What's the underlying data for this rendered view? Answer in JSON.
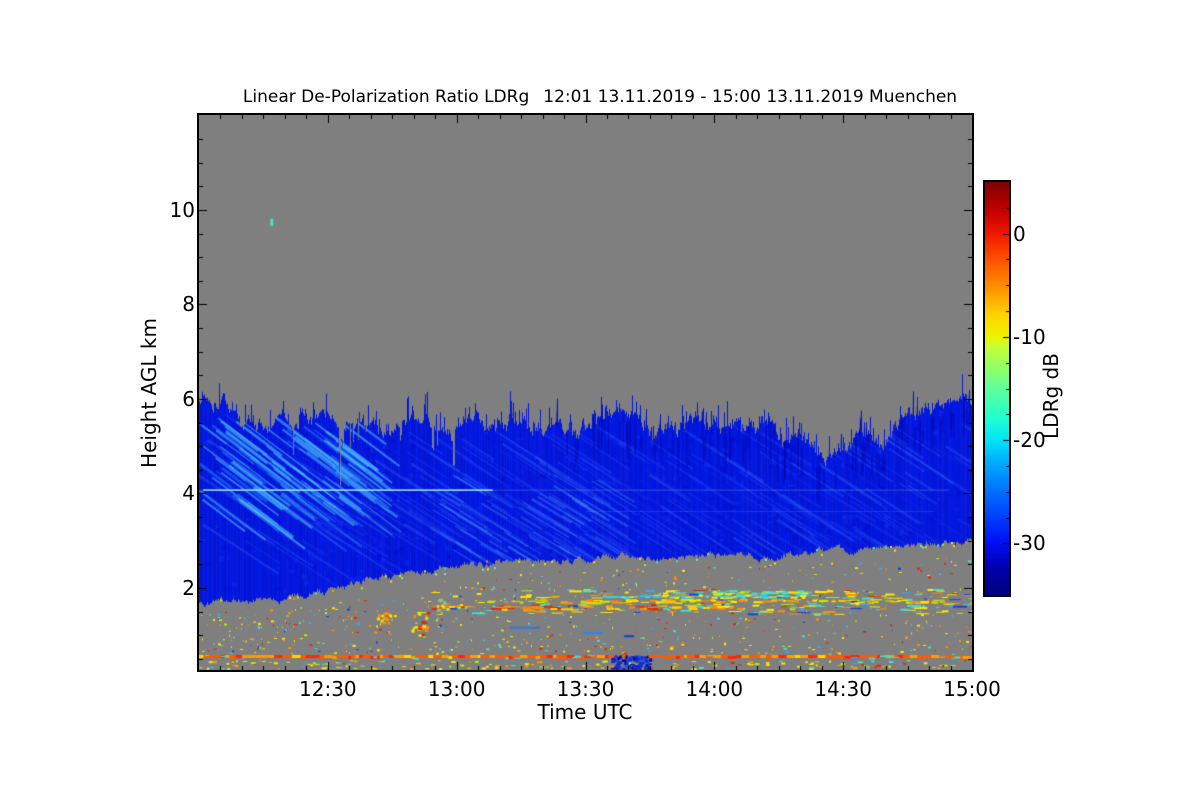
{
  "title": {
    "main": "Linear De-Polarization Ratio LDRg",
    "range": "12:01 13.11.2019 - 15:00 13.11.2019 Muenchen"
  },
  "axes": {
    "x_label": "Time UTC",
    "y_label": "Height AGL km"
  },
  "colorbar": {
    "label": "LDRg dB"
  },
  "chart_data": {
    "type": "heatmap",
    "title": "Linear De-Polarization Ratio LDRg  12:01 13.11.2019 - 15:00 13.11.2019 Muenchen",
    "xlabel": "Time UTC",
    "ylabel": "Height AGL km",
    "x_range_utc": [
      "12:00",
      "15:00"
    ],
    "data_start_utc": "12:01",
    "y_range_km": [
      0.26,
      12.0
    ],
    "x_ticks": [
      {
        "label": "12:30",
        "minutes": 30
      },
      {
        "label": "13:00",
        "minutes": 60
      },
      {
        "label": "13:30",
        "minutes": 90
      },
      {
        "label": "14:00",
        "minutes": 120
      },
      {
        "label": "14:30",
        "minutes": 150
      },
      {
        "label": "15:00",
        "minutes": 180
      }
    ],
    "x_minor_step_min": 5,
    "y_ticks": [
      {
        "label": "2",
        "km": 2
      },
      {
        "label": "4",
        "km": 4
      },
      {
        "label": "6",
        "km": 6
      },
      {
        "label": "8",
        "km": 8
      },
      {
        "label": "10",
        "km": 10
      }
    ],
    "y_minor_step_km": 0.5,
    "cbar": {
      "label": "LDRg dB",
      "range_db": [
        -35,
        5
      ],
      "ticks": [
        {
          "label": "0",
          "db": 0
        },
        {
          "label": "-10",
          "db": -10
        },
        {
          "label": "-20",
          "db": -20
        },
        {
          "label": "-30",
          "db": -30
        }
      ],
      "minor_step_db": 2.5,
      "jet_stops": [
        [
          0.0,
          "#00007F"
        ],
        [
          0.06,
          "#0000A8"
        ],
        [
          0.125,
          "#000DF4"
        ],
        [
          0.19,
          "#0040FF"
        ],
        [
          0.26,
          "#0078FF"
        ],
        [
          0.33,
          "#00B4FF"
        ],
        [
          0.375,
          "#00E4F8"
        ],
        [
          0.43,
          "#22FFD0"
        ],
        [
          0.5,
          "#60FF9A"
        ],
        [
          0.56,
          "#9CFF5C"
        ],
        [
          0.6,
          "#C4FF36"
        ],
        [
          0.625,
          "#EEF400"
        ],
        [
          0.68,
          "#FFD200"
        ],
        [
          0.75,
          "#FF8C00"
        ],
        [
          0.82,
          "#FF4A00"
        ],
        [
          0.875,
          "#F01800"
        ],
        [
          0.93,
          "#C40000"
        ],
        [
          1.0,
          "#7F0000"
        ]
      ]
    },
    "no_signal_color": "#7F7F7F",
    "seed": 20191113,
    "description": "Depolarization lidar time-height plot: ice/mixed cloud of low LDR (~-32 dB, dark blue with lighter fall streaks) between ~1.7-3 km base and ~5-6 km spiky top; gray = no signal; noisy speckle band (yellow/orange/cyan, LDR -5..-15 dB) at 1.4-2.0 km; continuous orange-red aerosol line at ~0.55 km; lone turquoise echo at 9.75 km 12:17.",
    "layers": {
      "cloud": {
        "body_colors": [
          "#0A1BE0",
          "#0215D5",
          "#0018E2"
        ],
        "top_km": {
          "t": [
            0,
            0.03,
            0.06,
            0.1,
            0.14,
            0.18,
            0.22,
            0.26,
            0.3,
            0.35,
            0.4,
            0.45,
            0.5,
            0.55,
            0.6,
            0.65,
            0.7,
            0.74,
            0.78,
            0.81,
            0.84,
            0.87,
            0.9,
            0.94,
            1.0
          ],
          "v": [
            5.85,
            5.8,
            5.6,
            5.5,
            5.45,
            5.5,
            5.55,
            5.5,
            5.45,
            5.5,
            5.45,
            5.5,
            5.45,
            5.4,
            5.4,
            5.35,
            5.3,
            5.25,
            5.1,
            4.95,
            4.85,
            5.2,
            5.5,
            5.8,
            5.95
          ]
        },
        "base_km": {
          "t": [
            0,
            0.06,
            0.12,
            0.17,
            0.22,
            0.28,
            0.34,
            0.4,
            0.5,
            0.6,
            0.7,
            0.8,
            0.9,
            1.0
          ],
          "v": [
            1.7,
            1.75,
            1.82,
            1.95,
            2.15,
            2.35,
            2.45,
            2.52,
            2.6,
            2.66,
            2.7,
            2.78,
            2.85,
            2.95
          ]
        },
        "mottle": {
          "n": 520,
          "colors": [
            "rgba(8,25,225,0.45)",
            "rgba(0,5,185,0.30)",
            "rgba(25,60,245,0.28)"
          ]
        },
        "streak_sets": [
          {
            "n": 220,
            "t": [
              0,
              1
            ],
            "h": [
              3.0,
              5.7
            ],
            "colors": [
              "rgba(35,70,245,0.35)",
              "rgba(20,40,230,0.30)",
              "rgba(60,110,255,0.30)"
            ],
            "w": [
              1,
              3
            ],
            "len": [
              25,
              85
            ],
            "slope": 0.65
          },
          {
            "n": 110,
            "t": [
              0,
              0.2
            ],
            "h": [
              3.8,
              5.65
            ],
            "colors": [
              "rgba(70,190,255,0.55)",
              "rgba(90,215,255,0.50)",
              "rgba(45,140,255,0.45)"
            ],
            "w": [
              1,
              3
            ],
            "len": [
              25,
              70
            ],
            "slope": 0.75
          },
          {
            "n": 60,
            "t": [
              0.3,
              0.52
            ],
            "h": [
              2.8,
              4.4
            ],
            "colors": [
              "rgba(60,130,255,0.40)",
              "rgba(80,160,255,0.35)"
            ],
            "w": [
              1,
              2.5
            ],
            "len": [
              18,
              55
            ],
            "slope": 0.6
          },
          {
            "n": 120,
            "t": [
              0.12,
              1
            ],
            "h": [
              2.6,
              4.1
            ],
            "colors": [
              "rgba(10,25,215,0.35)",
              "rgba(35,70,240,0.30)"
            ],
            "w": [
              1,
              3
            ],
            "len": [
              20,
              70
            ],
            "slope": 0.6
          }
        ],
        "vertical_dark": {
          "n": 140,
          "t": [
            0.45,
            1.0
          ],
          "color": "rgba(0,6,175,0.45)"
        },
        "bright_line": {
          "h": 4.07,
          "strong_t": [
            0.005,
            0.38
          ],
          "faint_t": [
            0.38,
            0.97
          ],
          "strong_color": "rgba(150,225,255,0.9)",
          "faint_color": "rgba(90,150,255,0.45)"
        },
        "faint_line": {
          "h": 3.62,
          "t": [
            0.5,
            0.95
          ],
          "color": "rgba(80,130,255,0.30)"
        },
        "base_speckles": {
          "n": 48,
          "colors": [
            "#FFE000",
            "#70E8C0",
            "#B8F000",
            "#FF9000",
            "#40E0D0"
          ]
        }
      },
      "sparse_speckles": {
        "n": 640,
        "h_min": 0.62,
        "palette": [
          [
            "#FFE000",
            0.3
          ],
          [
            "#FF9000",
            0.18
          ],
          [
            "#E02800",
            0.13
          ],
          [
            "#40E0D0",
            0.13
          ],
          [
            "#35A8FF",
            0.08
          ],
          [
            "#B8F000",
            0.1
          ],
          [
            "#1040E0",
            0.04
          ],
          [
            "#FF5A00",
            0.04
          ]
        ]
      },
      "band": {
        "n": 240,
        "t": [
          0.27,
          1.0
        ],
        "h": [
          1.45,
          1.98
        ],
        "palette": [
          [
            "#FFE800",
            0.3
          ],
          [
            "#FF9000",
            0.17
          ],
          [
            "#40E0D0",
            0.2
          ],
          [
            "#E02800",
            0.1
          ],
          [
            "#B8F000",
            0.13
          ],
          [
            "#1040E0",
            0.05
          ],
          [
            "#35A8FF",
            0.05
          ]
        ],
        "rows": [
          {
            "n": 60,
            "t": [
              0.52,
              0.78
            ],
            "h": 1.83,
            "colors": [
              "#40E0D0",
              "#30C8E8",
              "#FFE800"
            ]
          },
          {
            "n": 80,
            "t": [
              0.4,
              0.97
            ],
            "h": 1.73,
            "colors": [
              "#FFE800",
              "#FFC800",
              "#FF9000",
              "#B8F000"
            ]
          },
          {
            "n": 55,
            "t": [
              0.3,
              0.7
            ],
            "h": 1.6,
            "colors": [
              "#FF8C00",
              "#E02800",
              "#FFD000"
            ]
          },
          {
            "n": 40,
            "t": [
              0.6,
              0.8
            ],
            "h": 1.92,
            "colors": [
              "#FFE800",
              "#40E0D0"
            ]
          }
        ]
      },
      "blobs": [
        {
          "t": 0.286,
          "h": [
            1.0,
            1.5
          ],
          "n": 22,
          "w": 18,
          "colors": [
            "#FFE000",
            "#FF9000",
            "#E02800",
            "#FFF400"
          ]
        },
        {
          "t": 0.238,
          "h": [
            1.26,
            1.5
          ],
          "n": 14,
          "w": 14,
          "colors": [
            "#FFE000",
            "#FF9000"
          ]
        },
        {
          "t": 0.315,
          "h": [
            1.55,
            1.78
          ],
          "n": 12,
          "w": 12,
          "colors": [
            "#FFE000",
            "#40E0D0",
            "#FF9000"
          ]
        }
      ],
      "blue_dashes": [
        {
          "t": 0.497,
          "h": 1.07,
          "w": 20,
          "color": "#2E86E8"
        },
        {
          "t": 0.55,
          "h": 1.0,
          "w": 10,
          "color": "#1040D0"
        },
        {
          "t": 0.402,
          "h": 1.18,
          "w": 30,
          "color": "#3078E0"
        }
      ],
      "surface_line": {
        "h": 0.56,
        "thickness": 3,
        "colors": [
          [
            "#FF5A00",
            0.45
          ],
          [
            "#FF2800",
            0.25
          ],
          [
            "#FF9C00",
            0.22
          ],
          [
            "#FFD700",
            0.08
          ]
        ],
        "cyan_overlay_n": 22,
        "cyan_colors": [
          "#40E0D0",
          "#2E9AFE"
        ]
      },
      "below_line_speckles": {
        "n": 170,
        "h": [
          0.3,
          0.47
        ],
        "palette": [
          [
            "#FFE000",
            0.42
          ],
          [
            "#FF9C00",
            0.2
          ],
          [
            "#E02800",
            0.08
          ],
          [
            "#40E0D0",
            0.12
          ],
          [
            "#B8F000",
            0.1
          ],
          [
            "#35A8FF",
            0.08
          ]
        ]
      },
      "above_line_speckles": {
        "n": 45,
        "h": [
          0.6,
          0.82
        ],
        "palette": [
          [
            "#FFE000",
            0.5
          ],
          [
            "#FF9000",
            0.2
          ],
          [
            "#40E0D0",
            0.15
          ],
          [
            "#E02800",
            0.15
          ]
        ]
      },
      "blue_patch": {
        "t": [
          0.532,
          0.583
        ],
        "h": [
          0.27,
          0.58
        ],
        "n": 110,
        "palette": [
          [
            "#1030C8",
            0.5
          ],
          [
            "#000898",
            0.3
          ],
          [
            "#2850E8",
            0.2
          ]
        ]
      },
      "dot": {
        "t": 0.0935,
        "h": 9.75,
        "color": "#3CE8C4"
      }
    }
  }
}
